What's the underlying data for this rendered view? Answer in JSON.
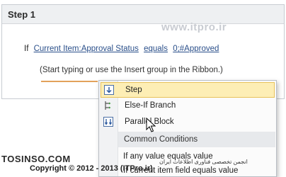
{
  "step": {
    "title": "Step 1"
  },
  "watermark_top": "www.itpro.ir",
  "condition": {
    "if_keyword": "If",
    "field": "Current Item:Approval Status",
    "operator": "equals",
    "value": "0;#Approved"
  },
  "hint": "(Start typing or use the Insert group in the Ribbon.)",
  "menu": {
    "items": [
      {
        "label": "Step",
        "icon": "step-down-arrow-icon"
      },
      {
        "label": "Else-If Branch",
        "icon": "branch-icon"
      },
      {
        "label": "Parallel Block",
        "icon": "parallel-block-icon"
      }
    ],
    "section_label": "Common Conditions",
    "condition_items": [
      "If any value equals value",
      "If current item field equals value"
    ]
  },
  "watermarks": {
    "brand": "TOSINSO.COM",
    "copyright": "Copyright © 2012 - 2013 (ITPro.ir)",
    "persian": "انجمن تخصصی فناوری اطلاعات ایران"
  },
  "colors": {
    "highlight_bg": "#fdeeb5",
    "highlight_border": "#e8c25a",
    "accent_line": "#e3a25b",
    "link_blue": "#2a4f8a"
  }
}
